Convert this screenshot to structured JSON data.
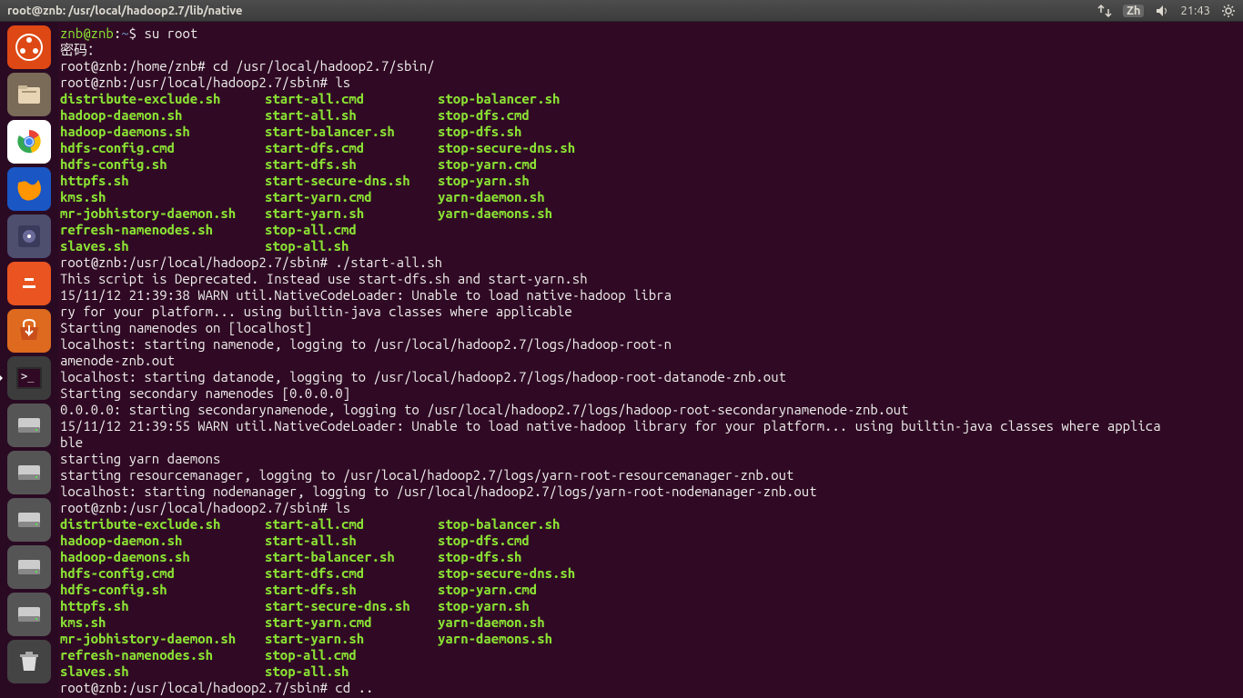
{
  "topbar": {
    "title": "root@znb: /usr/local/hadoop2.7/lib/native",
    "ime": "Zh",
    "time": "21:43"
  },
  "launcher": [
    {
      "name": "dash-icon",
      "bg": "#dd4814"
    },
    {
      "name": "files-icon",
      "bg": "#7a6a58"
    },
    {
      "name": "chrome-icon",
      "bg": "#ffffff"
    },
    {
      "name": "firefox-icon",
      "bg": "#1a56c4"
    },
    {
      "name": "media-icon",
      "bg": "#4e4e6e"
    },
    {
      "name": "vlc-icon",
      "bg": "#e95420"
    },
    {
      "name": "software-icon",
      "bg": "#dd6a1f"
    },
    {
      "name": "terminal-icon",
      "bg": "#3c3c3c",
      "active": true
    },
    {
      "name": "drive-icon-1",
      "bg": "#555"
    },
    {
      "name": "drive-icon-2",
      "bg": "#555"
    },
    {
      "name": "drive-icon-3",
      "bg": "#555"
    },
    {
      "name": "drive-icon-4",
      "bg": "#555"
    },
    {
      "name": "drive-icon-5",
      "bg": "#555"
    },
    {
      "name": "trash-icon",
      "bg": "#444"
    }
  ],
  "terminal": {
    "prompt1_user": "znb@znb",
    "prompt1_sep": ":",
    "prompt1_path": "~",
    "prompt1_sym": "$ ",
    "cmd1": "su root",
    "pw_label": "密码：",
    "prompt2": "root@znb:/home/znb# ",
    "cmd2": "cd /usr/local/hadoop2.7/sbin/",
    "prompt3": "root@znb:/usr/local/hadoop2.7/sbin# ",
    "cmd3": "ls",
    "ls": [
      [
        "distribute-exclude.sh",
        "start-all.cmd",
        "stop-balancer.sh"
      ],
      [
        "hadoop-daemon.sh",
        "start-all.sh",
        "stop-dfs.cmd"
      ],
      [
        "hadoop-daemons.sh",
        "start-balancer.sh",
        "stop-dfs.sh"
      ],
      [
        "hdfs-config.cmd",
        "start-dfs.cmd",
        "stop-secure-dns.sh"
      ],
      [
        "hdfs-config.sh",
        "start-dfs.sh",
        "stop-yarn.cmd"
      ],
      [
        "httpfs.sh",
        "start-secure-dns.sh",
        "stop-yarn.sh"
      ],
      [
        "kms.sh",
        "start-yarn.cmd",
        "yarn-daemon.sh"
      ],
      [
        "mr-jobhistory-daemon.sh",
        "start-yarn.sh",
        "yarn-daemons.sh"
      ],
      [
        "refresh-namenodes.sh",
        "stop-all.cmd",
        ""
      ],
      [
        "slaves.sh",
        "stop-all.sh",
        ""
      ]
    ],
    "cmd4": "./start-all.sh",
    "output": [
      "This script is Deprecated. Instead use start-dfs.sh and start-yarn.sh",
      "15/11/12 21:39:38 WARN util.NativeCodeLoader: Unable to load native-hadoop libra",
      "ry for your platform... using builtin-java classes where applicable",
      "Starting namenodes on [localhost]",
      "localhost: starting namenode, logging to /usr/local/hadoop2.7/logs/hadoop-root-n",
      "amenode-znb.out",
      "localhost: starting datanode, logging to /usr/local/hadoop2.7/logs/hadoop-root-datanode-znb.out",
      "Starting secondary namenodes [0.0.0.0]",
      "0.0.0.0: starting secondarynamenode, logging to /usr/local/hadoop2.7/logs/hadoop-root-secondarynamenode-znb.out",
      "15/11/12 21:39:55 WARN util.NativeCodeLoader: Unable to load native-hadoop library for your platform... using builtin-java classes where applica",
      "ble",
      "starting yarn daemons",
      "starting resourcemanager, logging to /usr/local/hadoop2.7/logs/yarn-root-resourcemanager-znb.out",
      "localhost: starting nodemanager, logging to /usr/local/hadoop2.7/logs/yarn-root-nodemanager-znb.out"
    ],
    "cmd5": "ls",
    "cmd6": "cd .."
  }
}
